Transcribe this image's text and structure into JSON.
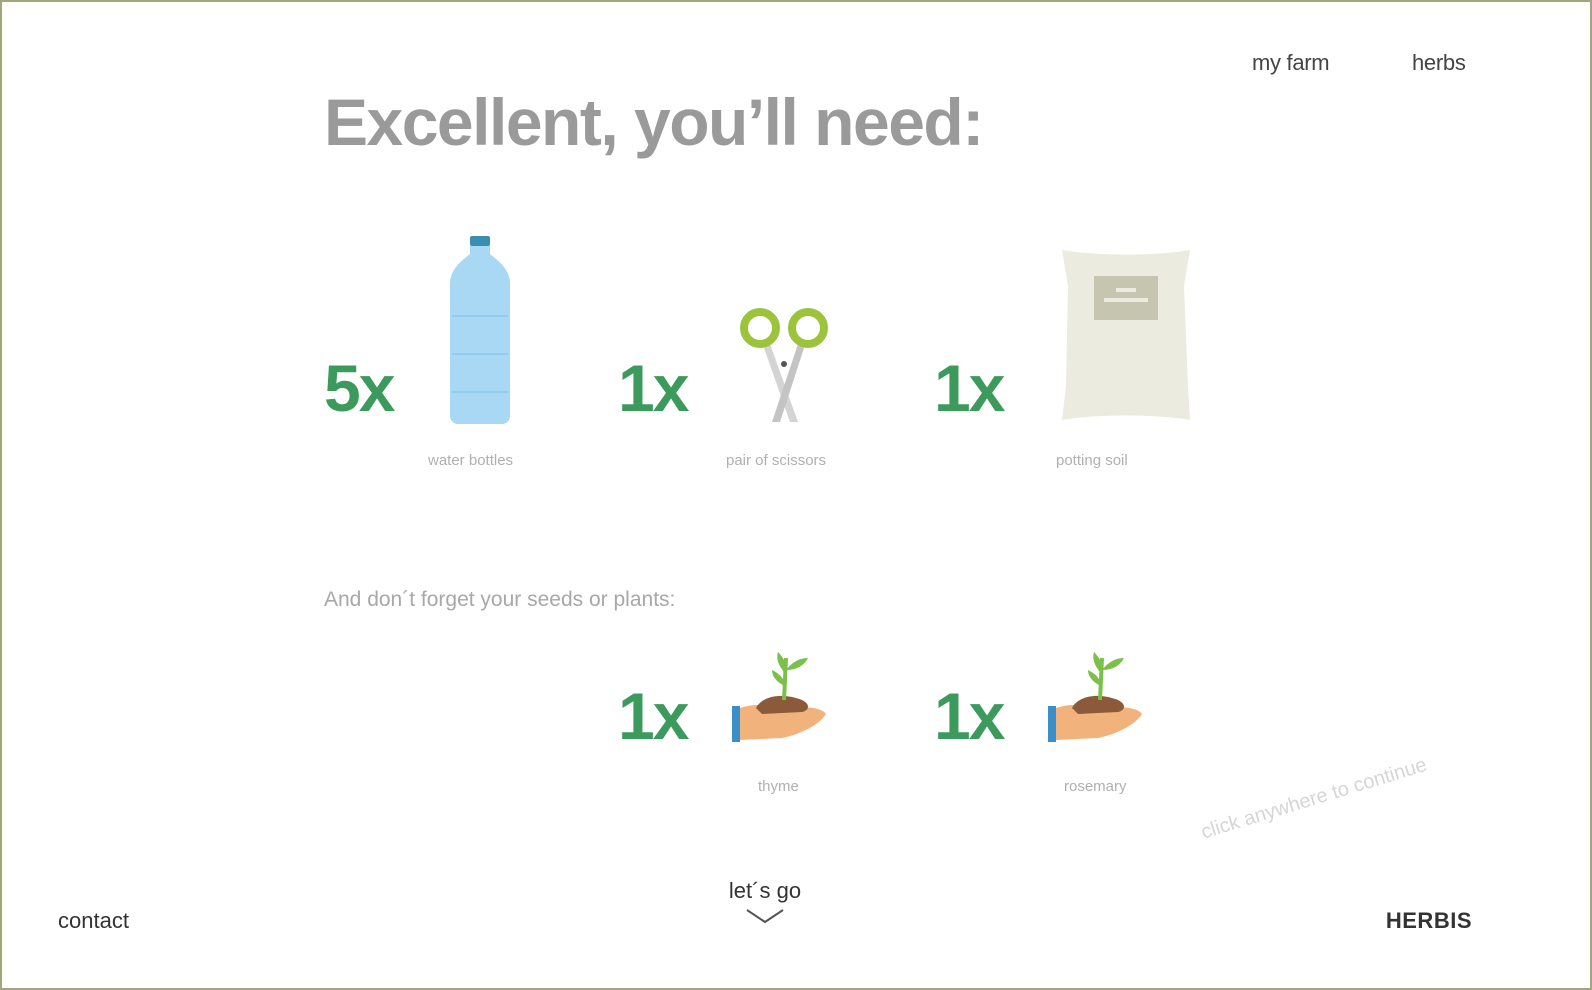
{
  "nav": {
    "my_farm": "my farm",
    "herbs": "herbs"
  },
  "headline": "Excellent, you’ll need:",
  "supplies": [
    {
      "quantity": "5x",
      "label": "water bottles",
      "icon": "water-bottle-icon"
    },
    {
      "quantity": "1x",
      "label": "pair of scissors",
      "icon": "scissors-icon"
    },
    {
      "quantity": "1x",
      "label": "potting soil",
      "icon": "soil-bag-icon"
    }
  ],
  "seeds_heading": "And don´t forget your seeds or plants:",
  "plants": [
    {
      "quantity": "1x",
      "label": "thyme",
      "icon": "seedling-in-hand-icon"
    },
    {
      "quantity": "1x",
      "label": "rosemary",
      "icon": "seedling-in-hand-icon"
    }
  ],
  "continue_hint": "click anywhere to continue",
  "footer": {
    "contact": "contact",
    "cta": "let´s go",
    "brand": "HERBIS"
  },
  "colors": {
    "quantity_green": "#3d9a5d",
    "frame_border": "#a3a57a",
    "headline_gray": "#9a9a9a"
  }
}
